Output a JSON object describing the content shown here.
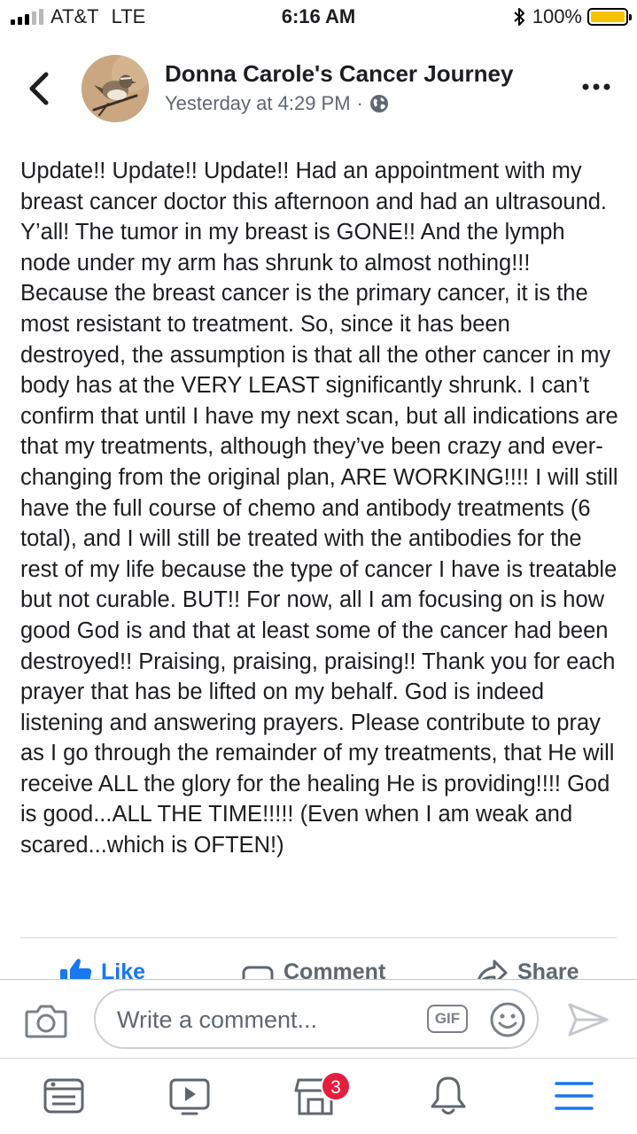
{
  "status_bar": {
    "carrier": "AT&T",
    "network": "LTE",
    "time": "6:16 AM",
    "battery": "100%",
    "signal_bars_active": 3,
    "signal_bars_total": 5
  },
  "post": {
    "page_name": "Donna Carole's Cancer Journey",
    "timestamp": "Yesterday at 4:29 PM",
    "separator": "·",
    "privacy_icon": "globe-icon",
    "body": "Update!! Update!!  Update!!  Had an appointment with my breast cancer doctor this afternoon and had an ultrasound. Y’all!  The tumor in my breast is GONE!! And the lymph node under my arm has shrunk to almost nothing!!!  Because the breast cancer is the primary cancer, it is the most resistant to treatment. So, since it has been destroyed, the assumption is that all the other cancer in my body has at the VERY LEAST significantly shrunk. I can’t confirm that until I have my next scan, but all indications are that my treatments, although they’ve been crazy and ever-changing from the original plan, ARE WORKING!!!!  I will still have the full course of chemo and antibody treatments (6 total), and I will still be treated with the antibodies for the rest of my life because the type of cancer I have is treatable but not curable. BUT!!  For now, all I am focusing on is how good God is and that at least some of the cancer had been destroyed!! Praising, praising, praising!!  Thank you for each prayer that has be lifted on my behalf. God is indeed listening and answering prayers. Please contribute to pray as I go through the remainder of my treatments, that He will receive ALL the glory for the healing He is providing!!!!  God is good...ALL THE TIME!!!!! (Even when I am weak and scared...which is OFTEN!)"
  },
  "actions": {
    "like": "Like",
    "comment": "Comment",
    "share": "Share"
  },
  "comment_bar": {
    "placeholder": "Write a comment...",
    "gif_label": "GIF"
  },
  "tab_bar": {
    "marketplace_badge": "3"
  },
  "colors": {
    "accent": "#1877f2",
    "badge": "#e41e3f",
    "battery": "#f5c400",
    "secondary_text": "#606770"
  }
}
